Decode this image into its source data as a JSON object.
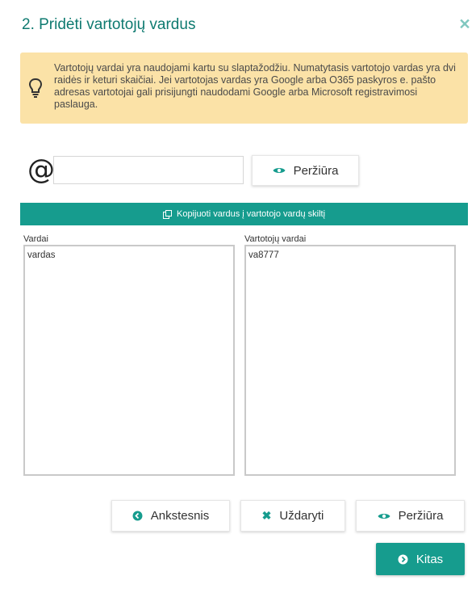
{
  "dialog": {
    "title": "2. Pridėti vartotojų vardus",
    "close_icon": "close-icon"
  },
  "info": {
    "icon": "lightbulb-icon",
    "text": "Vartotojų vardai yra naudojami kartu su slaptažodžiu. Numatytasis vartotojo vardas yra dvi raidės ir keturi skaičiai. Jei vartotojas vardas yra Google arba O365 paskyros e. pašto adresas vartotojai gali prisijungti naudodami Google arba Microsoft registravimosi paslauga."
  },
  "domain": {
    "at_symbol": "@",
    "value": "",
    "preview_label": "Peržiūra"
  },
  "copy_bar": {
    "label": "Kopijuoti vardus į vartotojo vardų skiltį",
    "icon": "copy-icon"
  },
  "names": {
    "label": "Vardai",
    "value": "vardas"
  },
  "usernames": {
    "label": "Vartotojų vardai",
    "value": "va8777"
  },
  "footer": {
    "previous_label": "Ankstesnis",
    "close_label": "Uždaryti",
    "preview_label": "Peržiūra",
    "next_label": "Kitas"
  },
  "colors": {
    "accent": "#169c8e",
    "title": "#0e7a70",
    "info_bg": "#fbe2a7"
  }
}
